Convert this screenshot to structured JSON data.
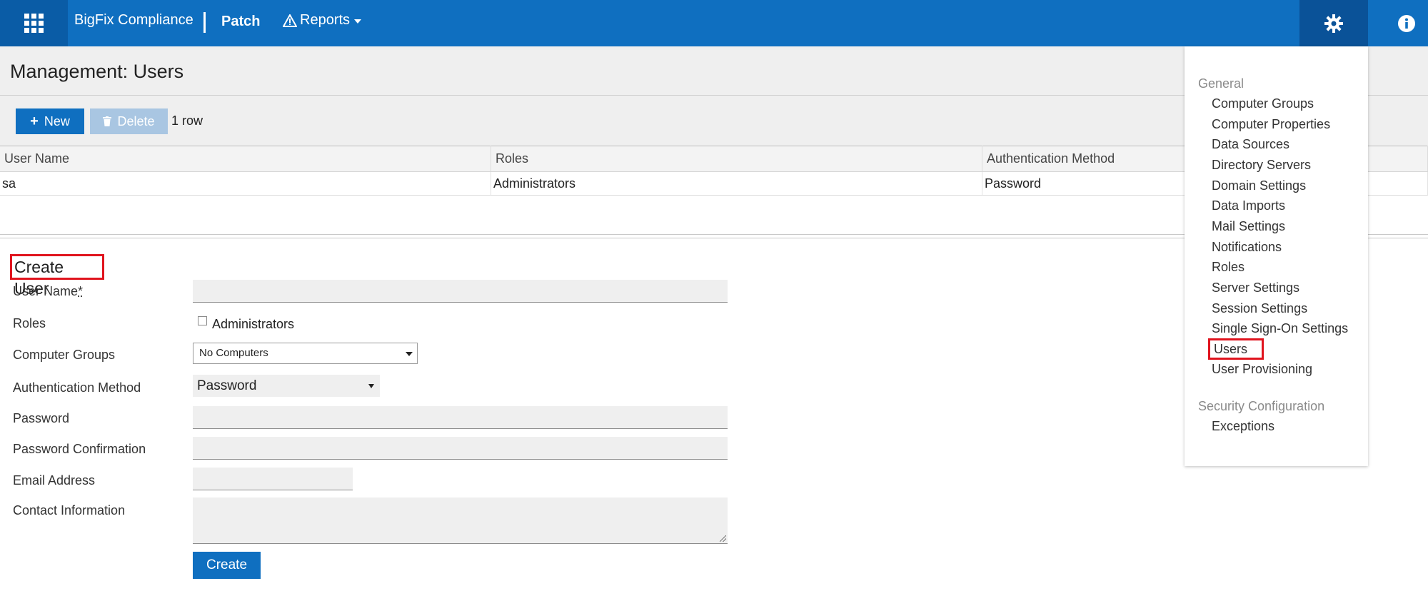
{
  "topbar": {
    "brand": "BigFix Compliance",
    "nav": {
      "patch": "Patch",
      "reports": "Reports"
    },
    "icons": [
      "apps-grid-icon",
      "warning-triangle-icon",
      "gear-icon",
      "info-icon"
    ]
  },
  "page": {
    "title": "Management: Users"
  },
  "toolbar": {
    "new_label": "New",
    "delete_label": "Delete",
    "row_count": "1 row"
  },
  "table": {
    "headers": [
      "User Name",
      "Roles",
      "Authentication Method"
    ],
    "rows": [
      [
        "sa",
        "Administrators",
        "Password"
      ]
    ]
  },
  "form": {
    "title": "Create User",
    "labels": {
      "user_name": "User Name",
      "required_marker": "*",
      "roles": "Roles",
      "computer_groups": "Computer Groups",
      "auth_method": "Authentication Method",
      "password": "Password",
      "password_confirmation": "Password Confirmation",
      "email": "Email Address",
      "contact": "Contact Information"
    },
    "roles_option": "Administrators",
    "computer_groups_value": "No Computers",
    "auth_method_value": "Password",
    "create_label": "Create"
  },
  "settings_menu": {
    "general_label": "General",
    "general_items": [
      "Computer Groups",
      "Computer Properties",
      "Data Sources",
      "Directory Servers",
      "Domain Settings",
      "Data Imports",
      "Mail Settings",
      "Notifications",
      "Roles",
      "Server Settings",
      "Session Settings",
      "Single Sign-On Settings",
      "Users",
      "User Provisioning"
    ],
    "security_label": "Security Configuration",
    "security_items": [
      "Exceptions"
    ],
    "highlighted_item": "Users"
  },
  "colors": {
    "primary": "#0f6fc0",
    "highlight_box": "#e0141e",
    "header_bg": "#efefef"
  }
}
